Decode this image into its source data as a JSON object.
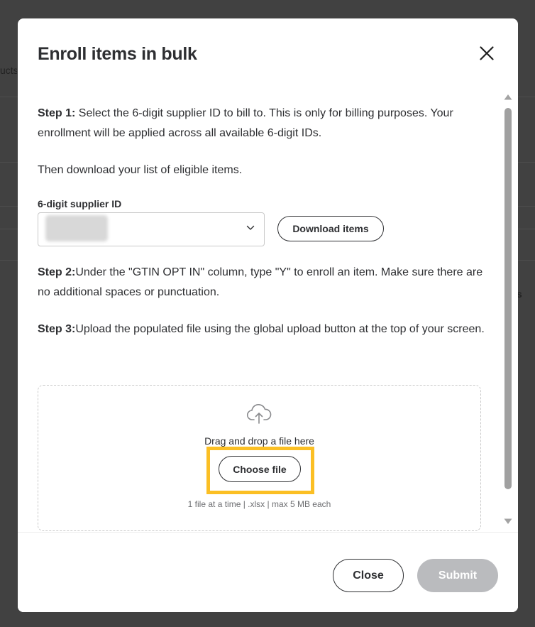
{
  "backdrop": {
    "left_fragment": "ucts",
    "right_fragment": "s"
  },
  "modal": {
    "title": "Enroll items in bulk",
    "close_icon": "close-icon"
  },
  "step1": {
    "label": "Step 1:",
    "text": " Select the 6-digit supplier ID to bill to. This is only for billing purposes. Your enrollment will be applied across all available 6-digit IDs."
  },
  "download_instruction": "Then download your list of eligible items.",
  "supplier_field": {
    "label": "6-digit supplier ID",
    "value": "",
    "value_redacted": true,
    "chevron_icon": "chevron-down-icon"
  },
  "download_button": "Download items",
  "step2": {
    "label": "Step 2:",
    "text": "Under the \"GTIN OPT IN\" column, type \"Y\" to enroll an item. Make sure there are no additional spaces or punctuation."
  },
  "step3": {
    "label": "Step 3:",
    "text": "Upload the populated file using the global upload button at the top of your screen."
  },
  "upload": {
    "icon": "cloud-upload-icon",
    "drag_text": "Drag and drop a file here",
    "choose_button": "Choose file",
    "hint": "1 file at a time | .xlsx | max 5 MB each",
    "highlight_color": "#fbbf24"
  },
  "footer": {
    "close_button": "Close",
    "submit_button": "Submit",
    "submit_disabled": true
  },
  "colors": {
    "text": "#2e2f32",
    "disabled_button": "#babbbe",
    "overlay": "#3c3c3c"
  }
}
